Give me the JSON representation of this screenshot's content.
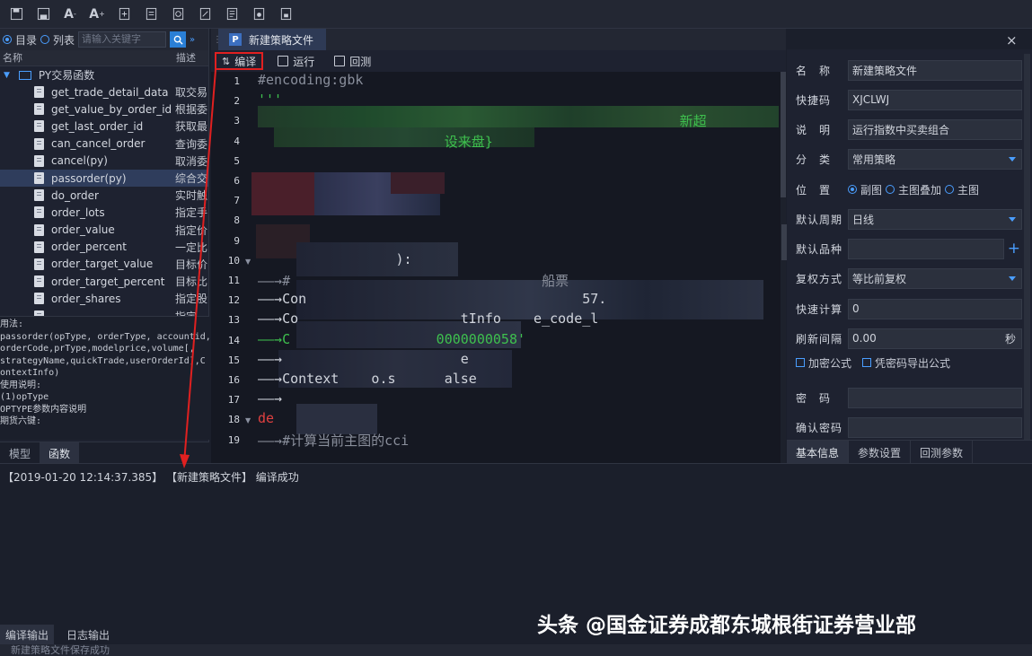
{
  "toolbar": {
    "icons": [
      "save-icon",
      "save-all-icon",
      "font-decrease-icon",
      "font-increase-icon",
      "export-icon",
      "import-icon",
      "refresh-icon",
      "doc-export-icon",
      "doc-import-icon",
      "doc-settings-icon",
      "doc-lock-icon"
    ],
    "labels": [
      "",
      "",
      "A",
      "A",
      "",
      "",
      "",
      "",
      "",
      "",
      ""
    ]
  },
  "left": {
    "mode_dir": "目录",
    "mode_list": "列表",
    "search_placeholder": "请输入关键字",
    "col_name": "名称",
    "col_desc": "描述",
    "root": "PY交易函数",
    "items": [
      {
        "name": "get_trade_detail_data",
        "desc": "取交易"
      },
      {
        "name": "get_value_by_order_id",
        "desc": "根据委"
      },
      {
        "name": "get_last_order_id",
        "desc": "获取最"
      },
      {
        "name": "can_cancel_order",
        "desc": "查询委"
      },
      {
        "name": "cancel(py)",
        "desc": "取消委"
      },
      {
        "name": "passorder(py)",
        "desc": "综合交"
      },
      {
        "name": "do_order",
        "desc": "实时触"
      },
      {
        "name": "order_lots",
        "desc": "指定手"
      },
      {
        "name": "order_value",
        "desc": "指定价"
      },
      {
        "name": "order_percent",
        "desc": "一定比"
      },
      {
        "name": "order_target_value",
        "desc": "目标价"
      },
      {
        "name": "order_target_percent",
        "desc": "目标比"
      },
      {
        "name": "order_shares",
        "desc": "指定股"
      },
      {
        "name": "",
        "desc": "指定"
      }
    ],
    "usage_lines": [
      "用法:",
      "passorder(opType, orderType, accountid,",
      "orderCode,prType,modelprice,volume[,",
      "strategyName,quickTrade,userOrderId],C",
      "ontextInfo)",
      "使用说明:",
      "(1)opType",
      "OPTYPE参数内容说明",
      "期货六键:"
    ],
    "tab_model": "模型",
    "tab_func": "函数"
  },
  "editor": {
    "file_tab": "新建策略文件",
    "file_icon_letter": "P",
    "tool_compile": "编译",
    "tool_run": "运行",
    "tool_backtest": "回测",
    "close": "×",
    "line_numbers": [
      "1",
      "2",
      "3",
      "4",
      "5",
      "6",
      "7",
      "8",
      "9",
      "10",
      "11",
      "12",
      "13",
      "14",
      "15",
      "16",
      "17",
      "18",
      "19"
    ],
    "visible_code": [
      {
        "line": 1,
        "text": "#encoding:gbk",
        "color": "#8a8f9c"
      },
      {
        "line": 2,
        "text": "'''",
        "color": "#3ec04e"
      },
      {
        "line": 3,
        "text": "                                                    新超",
        "color": "#3ec04e"
      },
      {
        "line": 4,
        "text": "                       设来盘}",
        "color": "#3ec04e"
      },
      {
        "line": 10,
        "text": "                 ):",
        "color": "#d0d4dc"
      },
      {
        "line": 11,
        "text": "——→#                               船票",
        "color": "#8a8f9c"
      },
      {
        "line": 12,
        "text": "——→Con                                  57.",
        "color": "#d0d4dc"
      },
      {
        "line": 13,
        "text": "——→Co                    tInfo    e_code_l",
        "color": "#d0d4dc"
      },
      {
        "line": 14,
        "text": "——→C                  0000000058'",
        "color": "#3ec04e"
      },
      {
        "line": 15,
        "text": "——→                      e",
        "color": "#d0d4dc"
      },
      {
        "line": 16,
        "text": "——→Context    o.s      alse",
        "color": "#d0d4dc"
      },
      {
        "line": 17,
        "text": "——→",
        "color": "#d0d4dc"
      },
      {
        "line": 18,
        "text": "de",
        "color": "#e04040"
      },
      {
        "line": 19,
        "text": "——→#计算当前主图的cci",
        "color": "#8a8f9c"
      }
    ]
  },
  "props": {
    "name_label": "名　称",
    "name_value": "新建策略文件",
    "quick_label": "快捷码",
    "quick_value": "XJCLWJ",
    "desc_label": "说　明",
    "desc_value": "运行指数中买卖组合",
    "cat_label": "分　类",
    "cat_value": "常用策略",
    "pos_label": "位　置",
    "pos_opt1": "副图",
    "pos_opt2": "主图叠加",
    "pos_opt3": "主图",
    "period_label": "默认周期",
    "period_value": "日线",
    "variety_label": "默认品种",
    "variety_value": "",
    "plus": "+",
    "adjust_label": "复权方式",
    "adjust_value": "等比前复权",
    "fastcalc_label": "快速计算",
    "fastcalc_value": "0",
    "refresh_label": "刷新间隔",
    "refresh_value": "0.00",
    "refresh_unit": "秒",
    "encrypt_label": "加密公式",
    "export_label": "凭密码导出公式",
    "pwd_label": "密　码",
    "pwd2_label": "确认密码",
    "tab_basic": "基本信息",
    "tab_params": "参数设置",
    "tab_backtest": "回测参数"
  },
  "log": {
    "line": "【2019-01-20 12:14:37.385】 【新建策略文件】 编译成功"
  },
  "bottom_tabs": {
    "compile_out": "编译输出",
    "log_out": "日志输出"
  },
  "status": {
    "text": "新建策略文件保存成功"
  },
  "watermark": "头条 @国金证券成都东城根街证券营业部",
  "colors": {
    "accent": "#4a9eff",
    "highlight": "#e02020",
    "bg": "#1b1f2b"
  }
}
